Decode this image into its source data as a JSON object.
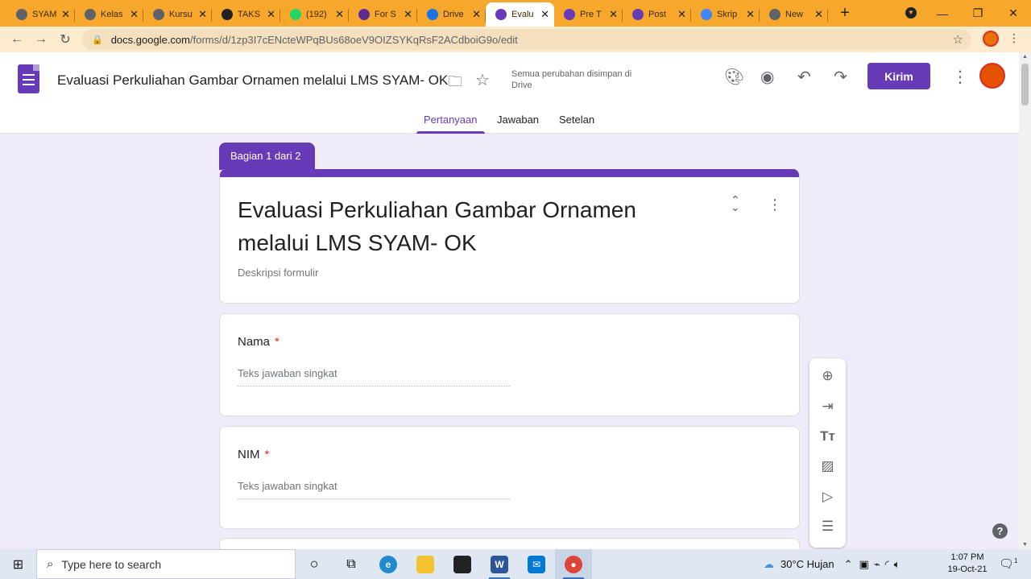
{
  "browser": {
    "tabs": [
      {
        "title": "SYAM",
        "fav_color": "#5f6368",
        "fav_icon": "chrome-icon"
      },
      {
        "title": "Kelas",
        "fav_color": "#5f6368",
        "fav_icon": "chrome-icon"
      },
      {
        "title": "Kursu",
        "fav_color": "#5f6368",
        "fav_icon": "chrome-icon"
      },
      {
        "title": "TAKS",
        "fav_color": "#222222",
        "fav_icon": "dark-app-icon"
      },
      {
        "title": "(192)",
        "fav_color": "#25d366",
        "fav_icon": "whatsapp-icon"
      },
      {
        "title": "For S",
        "fav_color": "#5c2d91",
        "fav_icon": "quiz-icon"
      },
      {
        "title": "Drive",
        "fav_color": "#1a73e8",
        "fav_icon": "drive-icon"
      },
      {
        "title": "Evalu",
        "fav_color": "#673ab7",
        "fav_icon": "forms-icon"
      },
      {
        "title": "Pre T",
        "fav_color": "#673ab7",
        "fav_icon": "forms-icon"
      },
      {
        "title": "Post",
        "fav_color": "#673ab7",
        "fav_icon": "forms-icon"
      },
      {
        "title": "Skrip",
        "fav_color": "#4285f4",
        "fav_icon": "docs-icon"
      },
      {
        "title": "New",
        "fav_color": "#5f6368",
        "fav_icon": "chrome-icon"
      }
    ],
    "active_tab_index": 7,
    "url_host": "docs.google.com",
    "url_path": "/forms/d/1zp3I7cENcteWPqBUs68oeV9OIZSYKqRsF2ACdboiG9o/edit"
  },
  "forms_header": {
    "doc_title": "Evaluasi Perkuliahan Gambar Ornamen melalui LMS SYAM- OK",
    "save_status": "Semua perubahan disimpan di Drive",
    "send_label": "Kirim",
    "tabs": [
      "Pertanyaan",
      "Jawaban",
      "Setelan"
    ],
    "active_tab": "Pertanyaan"
  },
  "form": {
    "section_label": "Bagian 1 dari 2",
    "title_line1": "Evaluasi Perkuliahan Gambar Ornamen",
    "title_line2": "melalui LMS SYAM- OK",
    "description_placeholder": "Deskripsi formulir",
    "questions": [
      {
        "label": "Nama",
        "required": "*",
        "answer_placeholder": "Teks jawaban singkat"
      },
      {
        "label": "NIM",
        "required": "*",
        "answer_placeholder": "Teks jawaban singkat"
      }
    ]
  },
  "toolbox": [
    "add-question-icon",
    "import-questions-icon",
    "add-title-icon",
    "add-image-icon",
    "add-video-icon",
    "add-section-icon"
  ],
  "taskbar": {
    "search_placeholder": "Type here to search",
    "weather": "30°C  Hujan",
    "time": "1:07 PM",
    "date": "19-Oct-21",
    "notification_count": "1"
  },
  "colors": {
    "accent": "#673ab7",
    "chrome_frame": "#f7a72b",
    "page_bg": "#f0ebf8"
  }
}
